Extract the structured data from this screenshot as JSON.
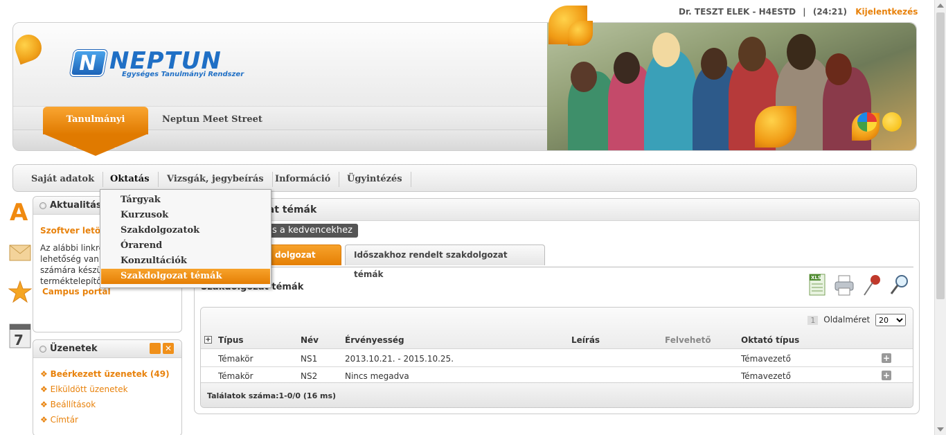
{
  "topbar": {
    "user": "Dr. TESZT ELEK - H4ESTD",
    "separator": "|",
    "timer": "(24:21)",
    "logout": "Kijelentkezés"
  },
  "logo": {
    "mark": "N",
    "name": "NEPTUN",
    "tagline": "Egységes Tanulmányi Rendszer"
  },
  "header_tabs": {
    "active": "Tanulmányi rendszer",
    "other": "Neptun Meet Street"
  },
  "menu": {
    "items": [
      {
        "label": "Saját adatok"
      },
      {
        "label": "Oktatás"
      },
      {
        "label": "Vizsgák, jegybeírás"
      },
      {
        "label": "Információ"
      },
      {
        "label": "Ügyintézés"
      }
    ]
  },
  "dropdown": {
    "items": [
      {
        "label": "Tárgyak"
      },
      {
        "label": "Kurzusok"
      },
      {
        "label": "Szakdolgozatok"
      },
      {
        "label": "Órarend"
      },
      {
        "label": "Konzultációk"
      },
      {
        "label": "Szakdolgozat témák"
      }
    ]
  },
  "news_panel": {
    "title": "Aktualitáso",
    "link": "Szoftver letö",
    "text": [
      "Az alábbi linkre",
      "lehetőség van",
      "számára készü",
      "terméktelepítő"
    ],
    "campus": "Campus portál"
  },
  "messages_panel": {
    "title": "Üzenetek",
    "items": [
      {
        "label": "Beérkezett üzenetek (49)"
      },
      {
        "label": "Elküldött üzenetek"
      },
      {
        "label": "Beállítások"
      },
      {
        "label": "Címtár"
      }
    ]
  },
  "main": {
    "title": "ozat témák",
    "favorite": "záadás a kedvencekhez",
    "tabs": [
      {
        "label": "dolgozat téma"
      },
      {
        "label": "Időszakhoz rendelt szakdolgozat témák"
      }
    ],
    "section_title": "Szakdolgozat témák"
  },
  "grid": {
    "page": "1",
    "page_size_label": "Oldalméret",
    "page_size": "20",
    "columns": [
      "Típus",
      "Név",
      "Érvényesség",
      "Leírás",
      "Felvehető",
      "Oktató típus"
    ],
    "rows": [
      [
        "Témakör",
        "NS1",
        "2013.10.21. - 2015.10.25.",
        "",
        "",
        "Témavezető"
      ],
      [
        "Témakör",
        "NS2",
        "Nincs megadva",
        "",
        "",
        "Témavezető"
      ]
    ],
    "footer": "Találatok száma:1-0/0 (16 ms)"
  },
  "colors": {
    "accent": "#e8820c",
    "logo_blue": "#1f6fc5"
  }
}
